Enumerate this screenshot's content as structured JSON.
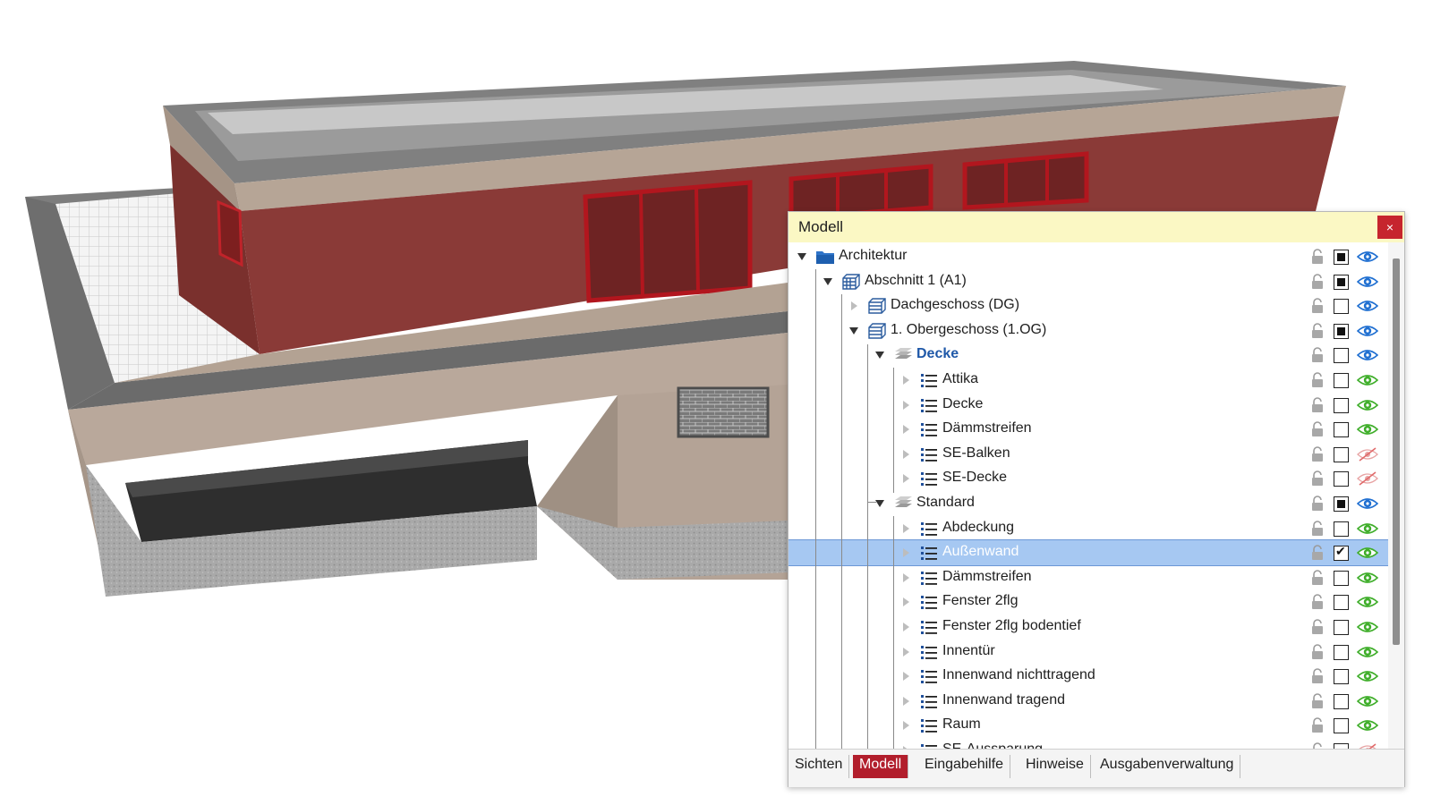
{
  "panel": {
    "title": "Modell",
    "close_label": "×"
  },
  "tree": [
    {
      "label": "Architektur",
      "depth": 0,
      "expander": "open",
      "icon": "folder-icon",
      "bold": false,
      "check": "filled",
      "eye": "blue",
      "selected": false
    },
    {
      "label": "Abschnitt 1 (A1)",
      "depth": 1,
      "expander": "open",
      "icon": "section-icon",
      "bold": false,
      "check": "filled",
      "eye": "blue",
      "selected": false
    },
    {
      "label": "Dachgeschoss (DG)",
      "depth": 2,
      "expander": "closed",
      "icon": "floor-icon",
      "bold": false,
      "check": "empty",
      "eye": "blue",
      "selected": false
    },
    {
      "label": "1. Obergeschoss (1.OG)",
      "depth": 2,
      "expander": "open",
      "icon": "floor-icon",
      "bold": false,
      "check": "filled",
      "eye": "blue",
      "selected": false
    },
    {
      "label": "Decke",
      "depth": 3,
      "expander": "open",
      "icon": "layers-icon",
      "bold": true,
      "check": "empty",
      "eye": "blue",
      "selected": false
    },
    {
      "label": "Attika",
      "depth": 4,
      "expander": "closed",
      "icon": "list-icon",
      "bold": false,
      "check": "empty",
      "eye": "green",
      "selected": false
    },
    {
      "label": "Decke",
      "depth": 4,
      "expander": "closed",
      "icon": "list-icon",
      "bold": false,
      "check": "empty",
      "eye": "green",
      "selected": false
    },
    {
      "label": "Dämmstreifen",
      "depth": 4,
      "expander": "closed",
      "icon": "list-icon",
      "bold": false,
      "check": "empty",
      "eye": "green",
      "selected": false
    },
    {
      "label": "SE-Balken",
      "depth": 4,
      "expander": "closed",
      "icon": "list-icon",
      "bold": false,
      "check": "empty",
      "eye": "hidden",
      "selected": false
    },
    {
      "label": "SE-Decke",
      "depth": 4,
      "expander": "closed",
      "icon": "list-icon",
      "bold": false,
      "check": "empty",
      "eye": "hidden",
      "selected": false
    },
    {
      "label": "Standard",
      "depth": 3,
      "expander": "open",
      "icon": "layers-icon",
      "bold": false,
      "check": "filled",
      "eye": "blue",
      "selected": false
    },
    {
      "label": "Abdeckung",
      "depth": 4,
      "expander": "closed",
      "icon": "list-icon",
      "bold": false,
      "check": "empty",
      "eye": "green",
      "selected": false
    },
    {
      "label": "Außenwand",
      "depth": 4,
      "expander": "closed",
      "icon": "list-icon",
      "bold": false,
      "check": "checked",
      "eye": "green",
      "selected": true
    },
    {
      "label": "Dämmstreifen",
      "depth": 4,
      "expander": "closed",
      "icon": "list-icon",
      "bold": false,
      "check": "empty",
      "eye": "green",
      "selected": false
    },
    {
      "label": "Fenster 2flg",
      "depth": 4,
      "expander": "closed",
      "icon": "list-icon",
      "bold": false,
      "check": "empty",
      "eye": "green",
      "selected": false
    },
    {
      "label": "Fenster 2flg bodentief",
      "depth": 4,
      "expander": "closed",
      "icon": "list-icon",
      "bold": false,
      "check": "empty",
      "eye": "green",
      "selected": false
    },
    {
      "label": "Innentür",
      "depth": 4,
      "expander": "closed",
      "icon": "list-icon",
      "bold": false,
      "check": "empty",
      "eye": "green",
      "selected": false
    },
    {
      "label": "Innenwand nichttragend",
      "depth": 4,
      "expander": "closed",
      "icon": "list-icon",
      "bold": false,
      "check": "empty",
      "eye": "green",
      "selected": false
    },
    {
      "label": "Innenwand tragend",
      "depth": 4,
      "expander": "closed",
      "icon": "list-icon",
      "bold": false,
      "check": "empty",
      "eye": "green",
      "selected": false
    },
    {
      "label": "Raum",
      "depth": 4,
      "expander": "closed",
      "icon": "list-icon",
      "bold": false,
      "check": "empty",
      "eye": "green",
      "selected": false
    },
    {
      "label": "SE-Aussparung",
      "depth": 4,
      "expander": "closed",
      "icon": "list-icon",
      "bold": false,
      "check": "empty",
      "eye": "hidden",
      "selected": false
    }
  ],
  "tabs": [
    {
      "label": "Sichten",
      "active": false
    },
    {
      "label": "Modell",
      "active": true
    },
    {
      "label": "Eingabehilfe",
      "active": false
    },
    {
      "label": "Hinweise",
      "active": false
    },
    {
      "label": "Ausgabenverwaltung",
      "active": false
    }
  ],
  "colors": {
    "facade_red": "#8a3a37",
    "plaster_beige": "#b8a79a",
    "roof_grey": "#8c8c8c",
    "panel_header": "#fbf8c4",
    "active_tab": "#b21e2c",
    "selection": "#a6c8f2",
    "eye_blue": "#1f6fd1",
    "eye_green": "#3fae2a"
  }
}
